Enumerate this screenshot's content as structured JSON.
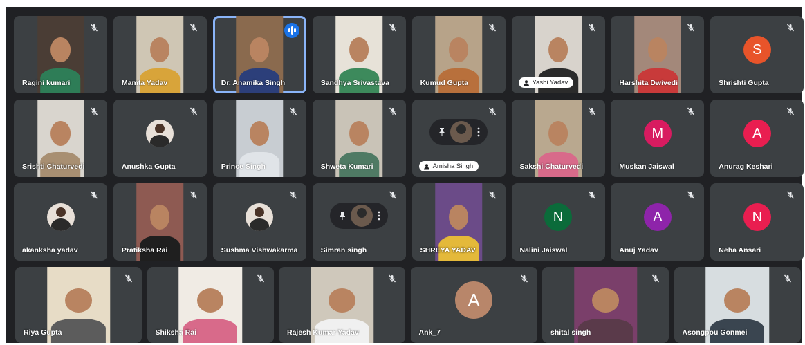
{
  "participants": [
    {
      "name": "Ragini kumari",
      "kind": "video",
      "bg": "#4a3d35",
      "shirt": "#2e7d57"
    },
    {
      "name": "Mamta Yadav",
      "kind": "video",
      "bg": "#cfc6b4",
      "shirt": "#d8a43a"
    },
    {
      "name": "Dr. Anamika Singh",
      "kind": "video",
      "bg": "#8a6a4e",
      "shirt": "#2c3f7a",
      "speaking": true
    },
    {
      "name": "Sandhya Srivastava",
      "kind": "video",
      "bg": "#e7e2d8",
      "shirt": "#3d8a5c"
    },
    {
      "name": "Kumud Gupta",
      "kind": "video",
      "bg": "#b7a389",
      "shirt": "#b8703c"
    },
    {
      "name": "Yashi Yadav",
      "kind": "video",
      "bg": "#d8d3cc",
      "shirt": "#2b2b2b",
      "chip": true
    },
    {
      "name": "Harshita Dwivedi",
      "kind": "video",
      "bg": "#a3887a",
      "shirt": "#c83a3a"
    },
    {
      "name": "Shrishti Gupta",
      "kind": "letter",
      "letter": "S",
      "color": "#e8542a"
    },
    {
      "name": "Srishti Chaturvedi",
      "kind": "video",
      "bg": "#d9d5ce",
      "shirt": "#a88f72"
    },
    {
      "name": "Anushka Gupta",
      "kind": "photo"
    },
    {
      "name": "Prince Singh",
      "kind": "video",
      "bg": "#c8cdd2",
      "shirt": "#e0e4e8"
    },
    {
      "name": "Shweta Kumari",
      "kind": "video",
      "bg": "#c9c3b7",
      "shirt": "#4f7a64"
    },
    {
      "name": "Amisha Singh",
      "kind": "pin",
      "chip": true
    },
    {
      "name": "Sakshi Chaturvedi",
      "kind": "video",
      "bg": "#b9a88f",
      "shirt": "#d86a8a"
    },
    {
      "name": "Muskan Jaiswal",
      "kind": "letter",
      "letter": "M",
      "color": "#d81b60"
    },
    {
      "name": "Anurag Keshari",
      "kind": "letter",
      "letter": "A",
      "color": "#e91e50"
    },
    {
      "name": "akanksha yadav",
      "kind": "photo"
    },
    {
      "name": "Pratiksha Rai",
      "kind": "video",
      "bg": "#8e5a52",
      "shirt": "#1f1f1f"
    },
    {
      "name": "Sushma Vishwakarma",
      "kind": "photo"
    },
    {
      "name": "Simran singh",
      "kind": "pin"
    },
    {
      "name": "SHREYA YADAV",
      "kind": "video",
      "bg": "#6b4b88",
      "shirt": "#e4b93a"
    },
    {
      "name": "Nalini Jaiswal",
      "kind": "letter",
      "letter": "N",
      "color": "#0b6b3a"
    },
    {
      "name": "Anuj Yadav",
      "kind": "letter",
      "letter": "A",
      "color": "#8e24aa"
    },
    {
      "name": "Neha Ansari",
      "kind": "letter",
      "letter": "N",
      "color": "#e91e50"
    },
    {
      "name": "Riya Gupta",
      "kind": "video",
      "bg": "#e7dcc6",
      "shirt": "#5c5c5c"
    },
    {
      "name": "Shiksha Rai",
      "kind": "video",
      "bg": "#f0ebe4",
      "shirt": "#d86a8a"
    },
    {
      "name": "Rajesh Kumar Yadav",
      "kind": "video",
      "bg": "#cfc8bb",
      "shirt": "#f0f0f0"
    },
    {
      "name": "Ank_7",
      "kind": "letter",
      "letter": "A",
      "color": "#b8866a",
      "big": true
    },
    {
      "name": "shital singh",
      "kind": "video",
      "bg": "#7a3f6a",
      "shirt": "#5a3a4a"
    },
    {
      "name": "Asongpou Gonmei",
      "kind": "video",
      "bg": "#d7dde0",
      "shirt": "#3a4550"
    }
  ],
  "icons": {
    "mute": "mic-off-icon",
    "pin": "pin-icon",
    "more": "more-vert-icon",
    "speaking": "audio-level-icon",
    "chip": "person-icon"
  }
}
